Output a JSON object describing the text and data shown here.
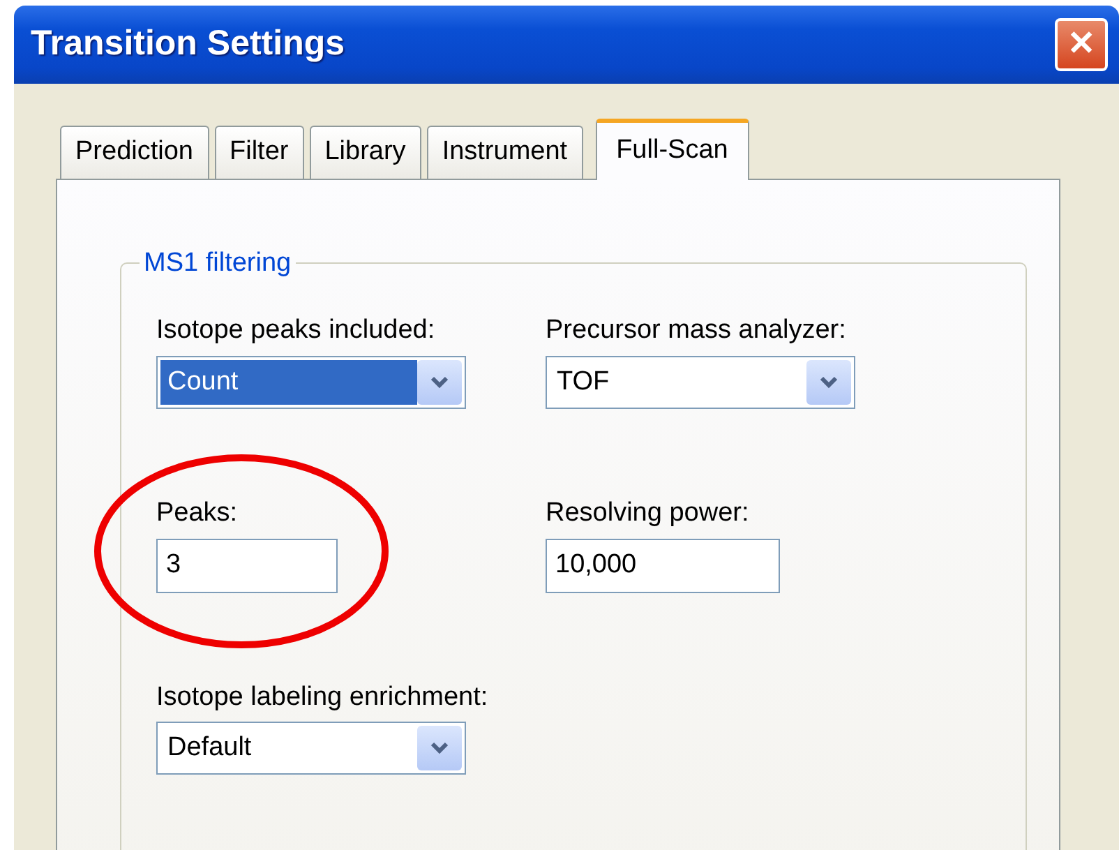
{
  "window": {
    "title": "Transition Settings",
    "close": "✕"
  },
  "tabs": [
    {
      "label": "Prediction",
      "selected": false
    },
    {
      "label": "Filter",
      "selected": false
    },
    {
      "label": "Library",
      "selected": false
    },
    {
      "label": "Instrument",
      "selected": false
    },
    {
      "label": "Full-Scan",
      "selected": true
    }
  ],
  "group": {
    "title": "MS1 filtering",
    "fields": [
      {
        "kind": "combo",
        "label": "Isotope peaks included:",
        "value": "Count",
        "highlighted": true,
        "circled": false
      },
      {
        "kind": "combo",
        "label": "Precursor mass analyzer:",
        "value": "TOF",
        "highlighted": false,
        "circled": false
      },
      {
        "kind": "text",
        "label": "Peaks:",
        "value": "3",
        "highlighted": false,
        "circled": true
      },
      {
        "kind": "text",
        "label": "Resolving power:",
        "value": "10,000",
        "highlighted": false,
        "circled": false
      },
      {
        "kind": "combo",
        "label": "Isotope labeling enrichment:",
        "value": "Default",
        "highlighted": false,
        "circled": false
      }
    ]
  }
}
